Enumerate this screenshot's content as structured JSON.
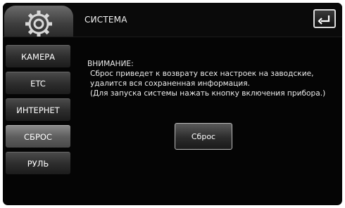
{
  "header": {
    "title": "СИСТЕМА",
    "left_icon": "gear-icon",
    "back_icon": "back-arrow-icon"
  },
  "sidebar": {
    "items": [
      {
        "label": "КАМЕРА",
        "active": false
      },
      {
        "label": "ETC",
        "active": false
      },
      {
        "label": "ИНТЕРНЕТ",
        "active": false
      },
      {
        "label": "СБРОС",
        "active": true
      },
      {
        "label": "РУЛЬ",
        "active": false
      }
    ]
  },
  "main": {
    "warning_lines": [
      "ВНИМАНИЕ:",
      "Сброс приведет к возврату всех настроек на заводские,",
      "удалится вся сохраненная информация.",
      "(Для запуска системы нажать кнопку включения прибора.)"
    ],
    "reset_label": "Сброс"
  },
  "colors": {
    "background": "#050505",
    "text": "#ececec",
    "active_tab": "#6e6e6e"
  }
}
